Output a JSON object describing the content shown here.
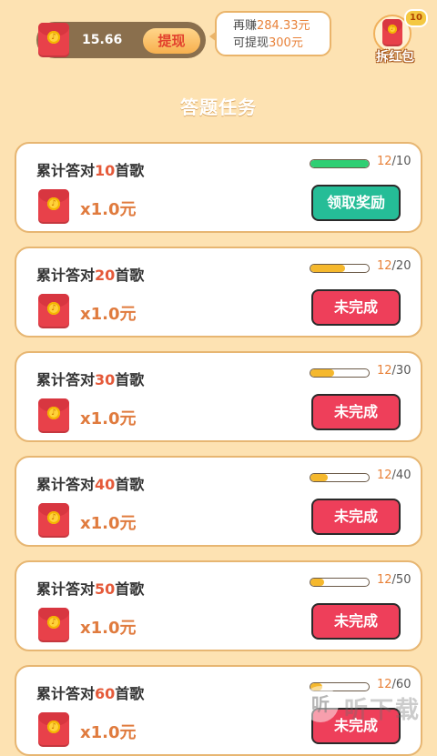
{
  "header": {
    "balance": "15.66",
    "withdraw_label": "提现",
    "earn_prefix": "再赚",
    "earn_amount": "284.33元",
    "withdraw_prefix": "可提现",
    "withdraw_amount": "300元",
    "open_redpacket_label": "拆红包",
    "open_redpacket_count": "10"
  },
  "section_title": "答题任务",
  "tasks": [
    {
      "title_prefix": "累计答对",
      "target": "10",
      "title_suffix": "首歌",
      "reward": "x1.0元",
      "current": "12",
      "total": "/10",
      "progress": 1.0,
      "button": "领取奖励",
      "status": "claimable"
    },
    {
      "title_prefix": "累计答对",
      "target": "20",
      "title_suffix": "首歌",
      "reward": "x1.0元",
      "current": "12",
      "total": "/20",
      "progress": 0.6,
      "button": "未完成",
      "status": "incomplete"
    },
    {
      "title_prefix": "累计答对",
      "target": "30",
      "title_suffix": "首歌",
      "reward": "x1.0元",
      "current": "12",
      "total": "/30",
      "progress": 0.4,
      "button": "未完成",
      "status": "incomplete"
    },
    {
      "title_prefix": "累计答对",
      "target": "40",
      "title_suffix": "首歌",
      "reward": "x1.0元",
      "current": "12",
      "total": "/40",
      "progress": 0.3,
      "button": "未完成",
      "status": "incomplete"
    },
    {
      "title_prefix": "累计答对",
      "target": "50",
      "title_suffix": "首歌",
      "reward": "x1.0元",
      "current": "12",
      "total": "/50",
      "progress": 0.24,
      "button": "未完成",
      "status": "incomplete"
    },
    {
      "title_prefix": "累计答对",
      "target": "60",
      "title_suffix": "首歌",
      "reward": "x1.0元",
      "current": "12",
      "total": "/60",
      "progress": 0.2,
      "button": "未完成",
      "status": "incomplete"
    }
  ],
  "watermark": {
    "logo_glyph": "听",
    "text": "听下载"
  },
  "colors": {
    "background": "#fde2b2",
    "claim": "#25bd97",
    "pending": "#ee3f5a",
    "progress_done": "#2fcf73",
    "progress": "#f5b82d"
  }
}
